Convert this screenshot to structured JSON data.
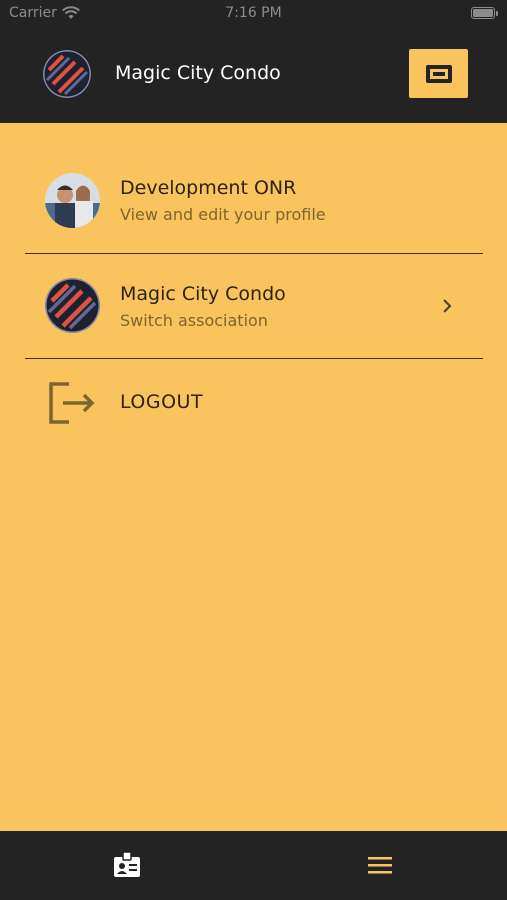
{
  "status_bar": {
    "carrier": "Carrier",
    "time": "7:16 PM"
  },
  "header": {
    "title": "Magic City Condo",
    "action_icon": "card-icon"
  },
  "menu": {
    "profile": {
      "title": "Development ONR",
      "subtitle": "View and edit your profile"
    },
    "association": {
      "title": "Magic City Condo",
      "subtitle": "Switch association"
    },
    "logout": {
      "label": "LOGOUT"
    }
  },
  "tab_bar": {
    "left_icon": "id-badge-icon",
    "right_icon": "hamburger-menu-icon"
  },
  "colors": {
    "background": "#f9c45e",
    "header": "#232323",
    "accent": "#f9c45e"
  }
}
